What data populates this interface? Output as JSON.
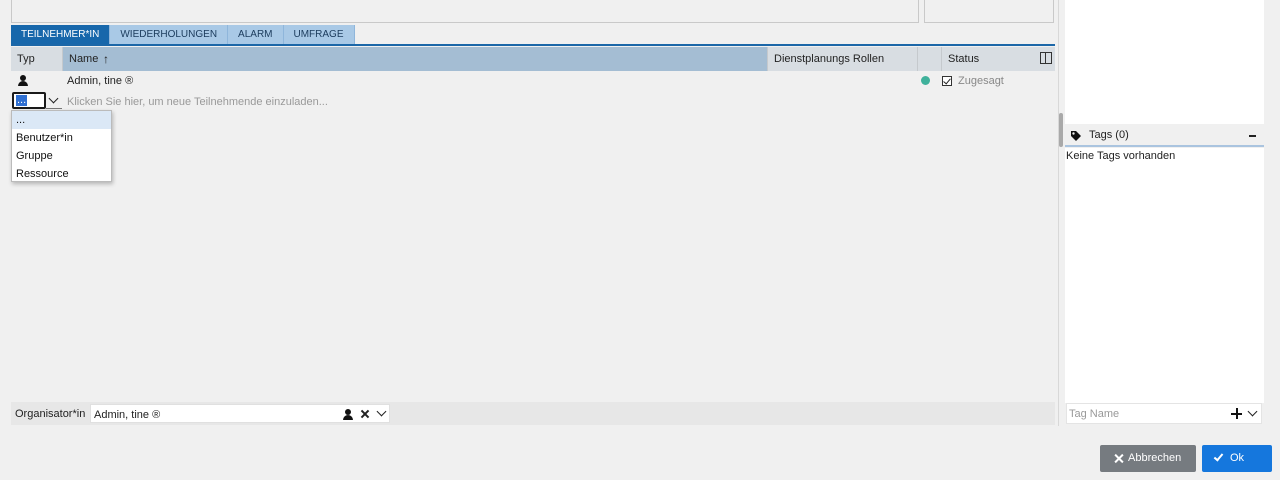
{
  "tabs": [
    {
      "label": "TEILNEHMER*IN",
      "active": true
    },
    {
      "label": "WIEDERHOLUNGEN",
      "active": false
    },
    {
      "label": "ALARM",
      "active": false
    },
    {
      "label": "UMFRAGE",
      "active": false
    }
  ],
  "grid": {
    "columns": {
      "type": "Typ",
      "name": "Name",
      "roles": "Dienstplanungs Rollen",
      "status": "Status"
    },
    "sort": {
      "column": "Name",
      "direction": "ascending"
    },
    "rows": [
      {
        "type_icon": "person-icon",
        "name": "Admin, tine ®",
        "status_dot_color": "#3fb19b",
        "status_checked": true,
        "status": "Zugesagt"
      }
    ],
    "new_row": {
      "type_value": "...",
      "invite_placeholder": "Klicken Sie hier, um neue Teilnehmende einzuladen..."
    }
  },
  "type_dropdown": {
    "options": [
      "...",
      "Benutzer*in",
      "Gruppe",
      "Ressource"
    ],
    "selected_index": 0
  },
  "organizer": {
    "label": "Organisator*in",
    "value": "Admin, tine ®"
  },
  "tags": {
    "title": "Tags (0)",
    "empty_text": "Keine Tags vorhanden",
    "input_placeholder": "Tag Name"
  },
  "buttons": {
    "cancel": "Abbrechen",
    "ok": "Ok"
  },
  "colors": {
    "accent": "#1767ab",
    "ok_button": "#1577dd",
    "cancel_button": "#767b80",
    "status_accepted": "#3fb19b"
  }
}
